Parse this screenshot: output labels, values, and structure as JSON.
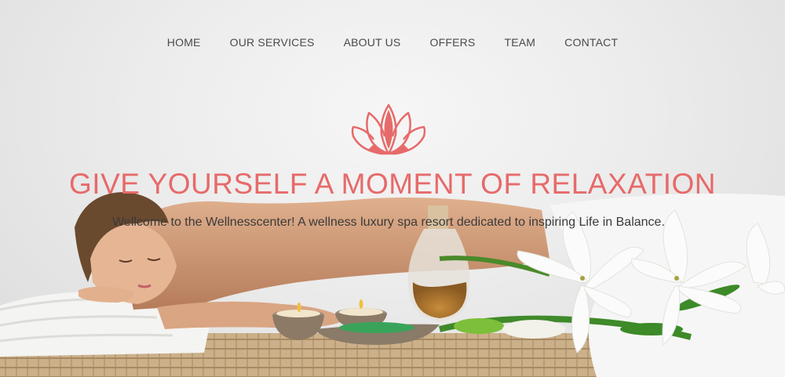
{
  "nav": {
    "items": [
      {
        "label": "HOME"
      },
      {
        "label": "OUR SERVICES"
      },
      {
        "label": "ABOUT US"
      },
      {
        "label": "OFFERS"
      },
      {
        "label": "TEAM"
      },
      {
        "label": "CONTACT"
      }
    ]
  },
  "hero": {
    "logo_icon": "lotus-icon",
    "headline": "GIVE YOURSELF A MOMENT OF RELAXATION",
    "subline": "Wellcome to the Wellnesscenter! A wellness luxury spa resort dedicated to inspiring Life in Balance."
  },
  "colors": {
    "accent": "#e76a6a",
    "nav_text": "#4a4a4a",
    "background": "#ececec"
  }
}
